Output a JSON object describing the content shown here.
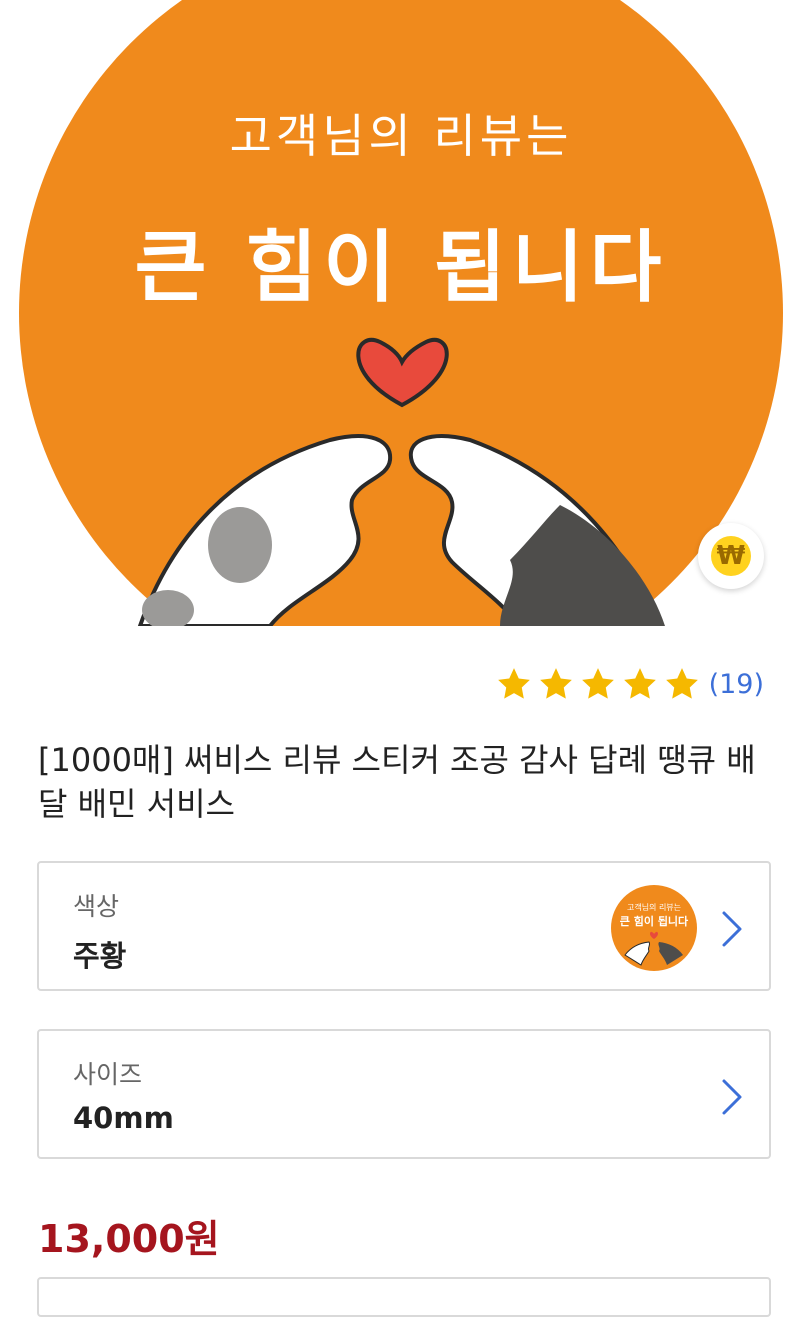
{
  "hero": {
    "line1": "고객님의 리뷰는",
    "line2": "큰 힘이 됩니다",
    "bg_color": "#f08a1c",
    "won_badge": "₩"
  },
  "rating": {
    "stars": 5,
    "count_text": "(19)",
    "star_color": "#f5b800"
  },
  "product": {
    "title": "[1000매] 써비스 리뷰 스티커 조공 감사 답례 땡큐 배달 배민 서비스",
    "price": "13,000원",
    "price_color": "#a5151e"
  },
  "options": {
    "color": {
      "label": "색상",
      "value": "주황",
      "thumb_line1": "고객님의 리뷰는",
      "thumb_line2": "큰 힘이 됩니다"
    },
    "size": {
      "label": "사이즈",
      "value": "40mm"
    }
  },
  "icons": {
    "option_arrow": "chevron-right-icon",
    "rating_star": "star-icon",
    "won": "won-icon"
  }
}
